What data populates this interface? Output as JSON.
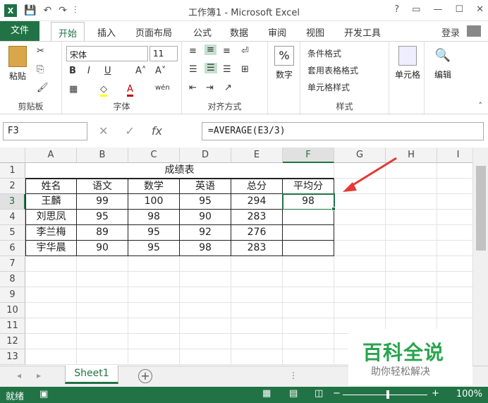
{
  "window": {
    "title": "工作簿1 - Microsoft Excel",
    "controls": [
      "?",
      "▭",
      "—",
      "☐",
      "✕"
    ]
  },
  "tabs": {
    "file": "文件",
    "items": [
      "开始",
      "插入",
      "页面布局",
      "公式",
      "数据",
      "审阅",
      "视图",
      "开发工具"
    ],
    "login": "登录"
  },
  "ribbon": {
    "clipboard": {
      "paste": "粘贴",
      "label": "剪贴板"
    },
    "font": {
      "name": "宋体",
      "size": "11",
      "label": "字体",
      "bold": "B",
      "italic": "I",
      "underline": "U",
      "grow": "A˄",
      "shrink": "A˅",
      "wen": "wén"
    },
    "align": {
      "label": "对齐方式"
    },
    "number": {
      "label": "数字"
    },
    "styles": {
      "cond": "条件格式",
      "table": "套用表格格式",
      "cell": "单元格样式",
      "label": "样式"
    },
    "cells": {
      "label": "单元格"
    },
    "edit": {
      "label": "编辑"
    }
  },
  "formula_bar": {
    "namebox": "F3",
    "fx": "fx",
    "formula": "=AVERAGE(E3/3)"
  },
  "grid": {
    "columns": [
      "A",
      "B",
      "C",
      "D",
      "E",
      "F",
      "G",
      "H",
      "I"
    ],
    "rows": [
      "1",
      "2",
      "3",
      "4",
      "5",
      "6",
      "7",
      "8",
      "9",
      "10",
      "11",
      "12",
      "13"
    ],
    "title": "成绩表",
    "headers": [
      "姓名",
      "语文",
      "数学",
      "英语",
      "总分",
      "平均分"
    ],
    "data": [
      [
        "王麟",
        "99",
        "100",
        "95",
        "294",
        "98"
      ],
      [
        "刘思凤",
        "95",
        "98",
        "90",
        "283",
        ""
      ],
      [
        "李兰梅",
        "89",
        "95",
        "92",
        "276",
        ""
      ],
      [
        "宇华晨",
        "90",
        "95",
        "98",
        "283",
        ""
      ]
    ],
    "selected": "F3"
  },
  "sheet_tab": "Sheet1",
  "status": {
    "ready": "就绪",
    "zoom": "100%"
  },
  "watermark": {
    "big": "百科全说",
    "small": "助你轻松解决"
  },
  "colors": {
    "accent": "#217346",
    "arrow": "#e53935"
  }
}
